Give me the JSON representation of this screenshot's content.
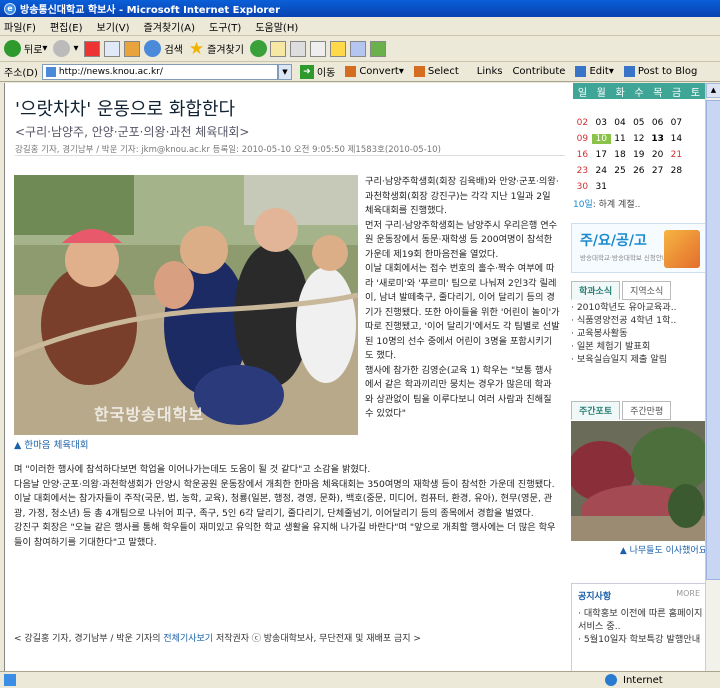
{
  "window": {
    "title": "방송통신대학교 학보사 - Microsoft Internet Explorer"
  },
  "menu": [
    "파일(F)",
    "편집(E)",
    "보기(V)",
    "즐겨찾기(A)",
    "도구(T)",
    "도움말(H)"
  ],
  "toolbar": {
    "back": "뒤로",
    "search": "검색",
    "favorites": "즐겨찾기"
  },
  "address": {
    "label": "주소(D)",
    "url": "http://news.knou.ac.kr/",
    "go": "이동",
    "convert": "Convert",
    "select": "Select",
    "links": "Links",
    "contribute": "Contribute",
    "edit": "Edit",
    "post": "Post to Blog"
  },
  "article": {
    "title": "'으랏차차' 운동으로 화합한다",
    "subtitle": "<구리·남양주, 안양·군포·의왕·과천 체육대회>",
    "byline": "강길홍 기자, 경기남부 / 박운 기자: jkm@knou.ac.kr   등록일: 2010-05-10 오전 9:05:50   제1583호(2010-05-10)",
    "photo_caption": "▲ 한마음 체육대회",
    "photo_watermark": "한국방송대학보",
    "right_paragraphs": [
      "구리·남양주학생회(회장 김육배)와 안양·군포·의왕·과천학생회(회장 강진구)는 각각 지난 1일과 2일 체육대회를 진행했다.",
      "먼저 구리·남양주학생회는 남양주시 우리은행 연수원 운동장에서 동문·재학생 등 200여명이 참석한 가운데 제19회 한마음전을 열었다.",
      "이날 대회에서는 접수 번호의 홀수·짝수 여부에 따라 '새로미'와 '푸르미' 팀으로 나눠져 2인3각 릴레이, 남녀 발떼축구, 줄다리기, 이어 달리기 등의 경기가 진행됐다. 또한 아이들을 위한 '어린이 놀이'가 따로 진행됐고, '이어 달리기'에서도 각 팀별로 선발된 10명의 선수 중에서 어린이 3명을 포함시키기도 했다.",
      "행사에 참가한 김영순(교육 1) 학우는 \"보통 행사에서 같은 학과끼리만 뭉치는 경우가 많은데 학과와 상관없이 팀을 이루다보니 여러 사람과 친해질 수 있었다\""
    ],
    "full_paragraphs": [
      "며 \"이러한 행사에 참석하다보면 학업을 이어나가는데도 도움이 될 것 같다\"고 소감을 밝혔다.",
      "다음날 안양·군포·의왕·과천학생회가 안양시 학운공원 운동장에서 개최한 한마음 체육대회는 350여명의 재학생 등이 참석한 가운데 진행됐다.",
      "이날 대회에서는 참가자들이 주작(국문, 법, 농학, 교육), 청룡(일본, 행정, 경영, 문화), 백호(중문, 미디어, 컴퓨터, 환경, 유아), 현무(영문, 관광, 가정, 청소년) 등 총 4개팀으로 나뉘어 피구, 족구, 5인 6각 달리기, 줄다리기, 단체줄넘기, 이어달리기 등의 종목에서 경합을 벌였다.",
      "강진구 회장은 \"오늘 같은 행사를 통해 학우들이 재미있고 유익한 학교 생활을 유지해 나가길 바란다\"며 \"앞으로 개최할 행사에는 더 많은 학우들이 참여하기를 기대한다\"고 말했다."
    ],
    "footer_prefix": "< 강길홍 기자, 경기남부 / 박운 기자의 ",
    "footer_link": "전체기사보기",
    "footer_suffix": " 저작권자 ⓒ 방송대학보사, 무단전재 및 재배포 금지 >"
  },
  "calendar": {
    "weekdays": [
      "일",
      "월",
      "화",
      "수",
      "목",
      "금",
      "토"
    ],
    "rows": [
      [
        "",
        "",
        "",
        "",
        "",
        "",
        ""
      ],
      [
        "02",
        "03",
        "04",
        "05",
        "06",
        "07",
        ""
      ],
      [
        "09",
        "10",
        "11",
        "12",
        "13",
        "14",
        ""
      ],
      [
        "16",
        "17",
        "18",
        "19",
        "20",
        "21",
        ""
      ],
      [
        "23",
        "24",
        "25",
        "26",
        "27",
        "28",
        ""
      ],
      [
        "30",
        "31",
        "",
        "",
        "",
        "",
        ""
      ]
    ],
    "note_month": "10일",
    "note_text": ": 하계 계절.."
  },
  "notice": {
    "title": "주/요/공/고",
    "sub": "방송대학교·방송대학보 신청안내"
  },
  "sidebar_tabs": [
    "학과소식",
    "지역소식"
  ],
  "sidebar_news": [
    "· 2010학년도 유아교육과..",
    "· 식품영양전공 4학년 1학..",
    "· 교육봉사활동",
    "· 일본 체험기 발표회",
    "· 보육실습일지 제출 알림"
  ],
  "weekly_tabs": [
    "주간포토",
    "주간만평"
  ],
  "weekly_caption": "▲ 나무들도 이사했어요",
  "board": {
    "title": "공지사항",
    "more": "MORE",
    "items": [
      "· 대학홍보 이전에 따른 홈페이지 서비스 중..",
      "· 5월10일자 학보특강 발행안내"
    ]
  },
  "status": {
    "zone": "Internet"
  },
  "colors": {
    "accent": "#3fa596",
    "link": "#1a60a8",
    "sunday": "#d03030",
    "today": "#8bc34a"
  }
}
